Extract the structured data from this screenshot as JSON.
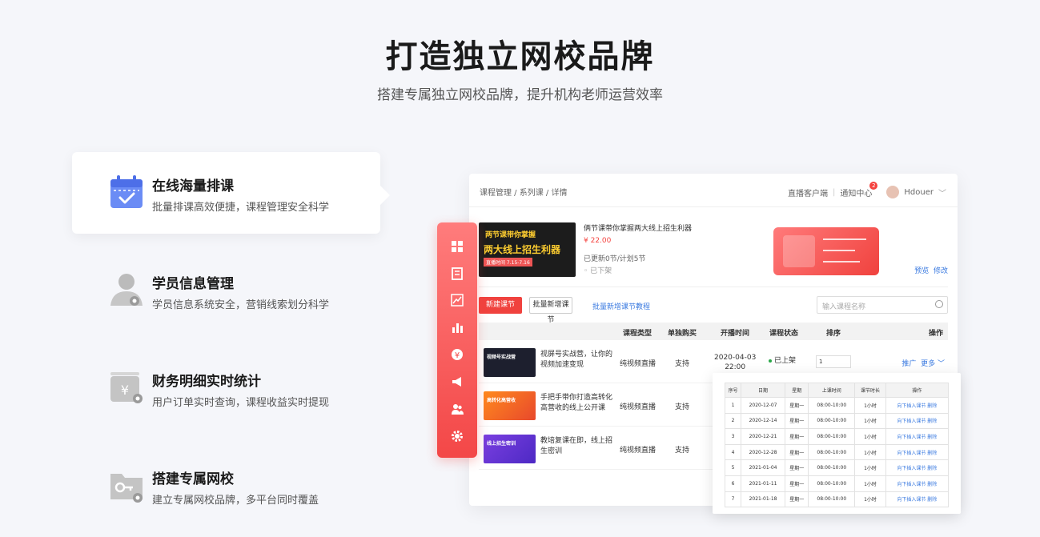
{
  "hero": {
    "title": "打造独立网校品牌",
    "subtitle": "搭建专属独立网校品牌，提升机构老师运营效率"
  },
  "features": [
    {
      "title": "在线海量排课",
      "desc": "批量排课高效便捷，课程管理安全科学",
      "icon": "calendar-icon"
    },
    {
      "title": "学员信息管理",
      "desc": "学员信息系统安全，营销线索划分科学",
      "icon": "user-icon"
    },
    {
      "title": "财务明细实时统计",
      "desc": "用户订单实时查询，课程收益实时提现",
      "icon": "finance-icon"
    },
    {
      "title": "搭建专属网校",
      "desc": "建立专属网校品牌，多平台同时覆盖",
      "icon": "key-folder-icon"
    }
  ],
  "app": {
    "breadcrumb": "课程管理 / 系列课 / 详情",
    "top_links": {
      "client": "直播客户端",
      "notify": "通知中心",
      "notify_count": "2",
      "user": "Hdouer"
    },
    "course": {
      "cover_tag": "两节课带你掌握",
      "cover_title": "两大线上招生利器",
      "cover_date": "直播时间 7.15-7.16",
      "name": "俩节课带你掌握两大线上招生利器",
      "price": "¥ 22.00",
      "progress": "已更新0节/计划5节",
      "status": "已下架",
      "preview": "预览",
      "edit": "修改"
    },
    "toolbar": {
      "new_lesson": "新建课节",
      "batch_add": "批量新增课节",
      "batch_tutorial": "批量新增课节教程",
      "search_placeholder": "输入课程名称"
    },
    "table_headers": [
      "课程类型",
      "单独购买",
      "开播时间",
      "课程状态",
      "排序",
      "操作"
    ],
    "rows": [
      {
        "thumb": "视频号实战营",
        "title": "视屏号实战营，让你的视频加速变现",
        "type": "纯视频直播",
        "buy": "支持",
        "date": "2020-04-03",
        "time": "22:00",
        "status": "已上架",
        "sort": "1",
        "promote": "推广",
        "more": "更多"
      },
      {
        "thumb": "高转化高营收",
        "title": "手把手带你打造高转化高营收的线上公开课",
        "type": "纯视频直播",
        "buy": "支持"
      },
      {
        "thumb": "线上招生密训",
        "title": "教培复课在即，线上招生密训",
        "type": "纯视频直播",
        "buy": "支持"
      }
    ]
  },
  "schedule": {
    "headers": [
      "序号",
      "日期",
      "星期",
      "上课时间",
      "课节时长",
      "操作"
    ],
    "rows": [
      [
        "1",
        "2020-12-07",
        "星期一",
        "08:00-10:00",
        "1小时",
        "向下插入课节 删除"
      ],
      [
        "2",
        "2020-12-14",
        "星期一",
        "08:00-10:00",
        "1小时",
        "向下插入课节 删除"
      ],
      [
        "3",
        "2020-12-21",
        "星期一",
        "08:00-10:00",
        "1小时",
        "向下插入课节 删除"
      ],
      [
        "4",
        "2020-12-28",
        "星期一",
        "08:00-10:00",
        "1小时",
        "向下插入课节 删除"
      ],
      [
        "5",
        "2021-01-04",
        "星期一",
        "08:00-10:00",
        "1小时",
        "向下插入课节 删除"
      ],
      [
        "6",
        "2021-01-11",
        "星期一",
        "08:00-10:00",
        "1小时",
        "向下插入课节 删除"
      ],
      [
        "7",
        "2021-01-18",
        "星期一",
        "08:00-10:00",
        "1小时",
        "向下插入课节 删除"
      ]
    ]
  },
  "colors": {
    "accent": "#f0423e",
    "link": "#3a7ae0"
  }
}
